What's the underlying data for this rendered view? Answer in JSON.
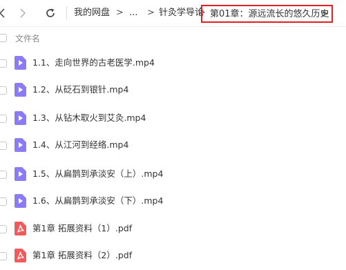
{
  "breadcrumb": {
    "items": [
      "我的网盘",
      "...",
      "针灸学导论"
    ],
    "current": "第01章：源远流长的悠久历史",
    "separator": ">"
  },
  "list": {
    "column_header": "文件名",
    "files": [
      {
        "name": "1.1、走向世界的古老医学.mp4",
        "type": "video"
      },
      {
        "name": "1.2、从砭石到银针.mp4",
        "type": "video"
      },
      {
        "name": "1.3、从钻木取火到艾灸.mp4",
        "type": "video"
      },
      {
        "name": "1.4、从江河到经络.mp4",
        "type": "video"
      },
      {
        "name": "1.5、从扁鹊到承淡安（上）.mp4",
        "type": "video"
      },
      {
        "name": "1.6、从扁鹊到承淡安（下）.mp4",
        "type": "video"
      },
      {
        "name": "第1章  拓展资料（1）.pdf",
        "type": "pdf"
      },
      {
        "name": "第1章  拓展资料（2）.pdf",
        "type": "pdf"
      }
    ]
  },
  "colors": {
    "video_icon": "#8b7cf6",
    "pdf_icon": "#f25b5b",
    "highlight_border": "#e02020"
  },
  "icons": {
    "back": "chevron-left-icon",
    "forward": "chevron-right-icon",
    "refresh": "refresh-icon"
  }
}
